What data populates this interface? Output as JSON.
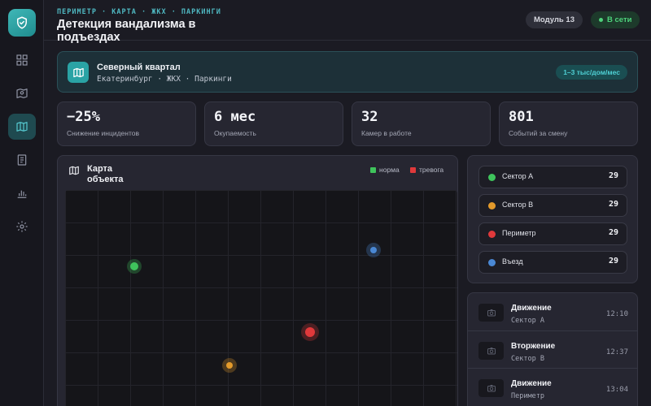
{
  "sidebar": {
    "logo_icon": "shield-check-icon",
    "items": [
      {
        "icon": "dashboard-icon",
        "active": false
      },
      {
        "icon": "camera-map-icon",
        "active": false
      },
      {
        "icon": "map-icon",
        "active": true
      },
      {
        "icon": "document-icon",
        "active": false
      },
      {
        "icon": "bar-chart-icon",
        "active": false
      },
      {
        "icon": "gear-icon",
        "active": false
      }
    ]
  },
  "header": {
    "breadcrumb": "ПЕРИМЕТР · КАРТА · ЖКХ · ПАРКИНГИ",
    "title": "Детекция вандализма в подъездах",
    "module_label": "Модуль 13",
    "status_label": "В сети"
  },
  "location": {
    "name": "Северный квартал",
    "subtitle": "Екатеринбург · ЖКХ · Паркинги",
    "price": "1–3 тыс/дом/мес"
  },
  "stats": [
    {
      "value": "−25%",
      "label": "Снижение инцидентов"
    },
    {
      "value": "6 мес",
      "label": "Окупаемость"
    },
    {
      "value": "32",
      "label": "Камер в работе"
    },
    {
      "value": "801",
      "label": "Событий за смену"
    }
  ],
  "map": {
    "title": "Карта объекта",
    "legend": [
      {
        "label": "норма",
        "color": "#3fc45c"
      },
      {
        "label": "тревога",
        "color": "#e0393b"
      }
    ],
    "markers": [
      {
        "status": "normal",
        "color": "#3fc45c"
      },
      {
        "status": "info",
        "color": "#4a88d4"
      },
      {
        "status": "alarm",
        "color": "#e0393b"
      },
      {
        "status": "warning",
        "color": "#e39a2b"
      }
    ]
  },
  "sectors": [
    {
      "name": "Сектор A",
      "count": "29",
      "color": "#3fc45c"
    },
    {
      "name": "Сектор B",
      "count": "29",
      "color": "#e39a2b"
    },
    {
      "name": "Периметр",
      "count": "29",
      "color": "#e0393b"
    },
    {
      "name": "Въезд",
      "count": "29",
      "color": "#4a88d4"
    }
  ],
  "events": [
    {
      "title": "Движение",
      "subtitle": "Сектор A",
      "time": "12:10"
    },
    {
      "title": "Вторжение",
      "subtitle": "Сектор B",
      "time": "12:37"
    },
    {
      "title": "Движение",
      "subtitle": "Периметр",
      "time": "13:04"
    }
  ],
  "colors": {
    "accent": "#2aa3a5",
    "online": "#4ed27b"
  }
}
